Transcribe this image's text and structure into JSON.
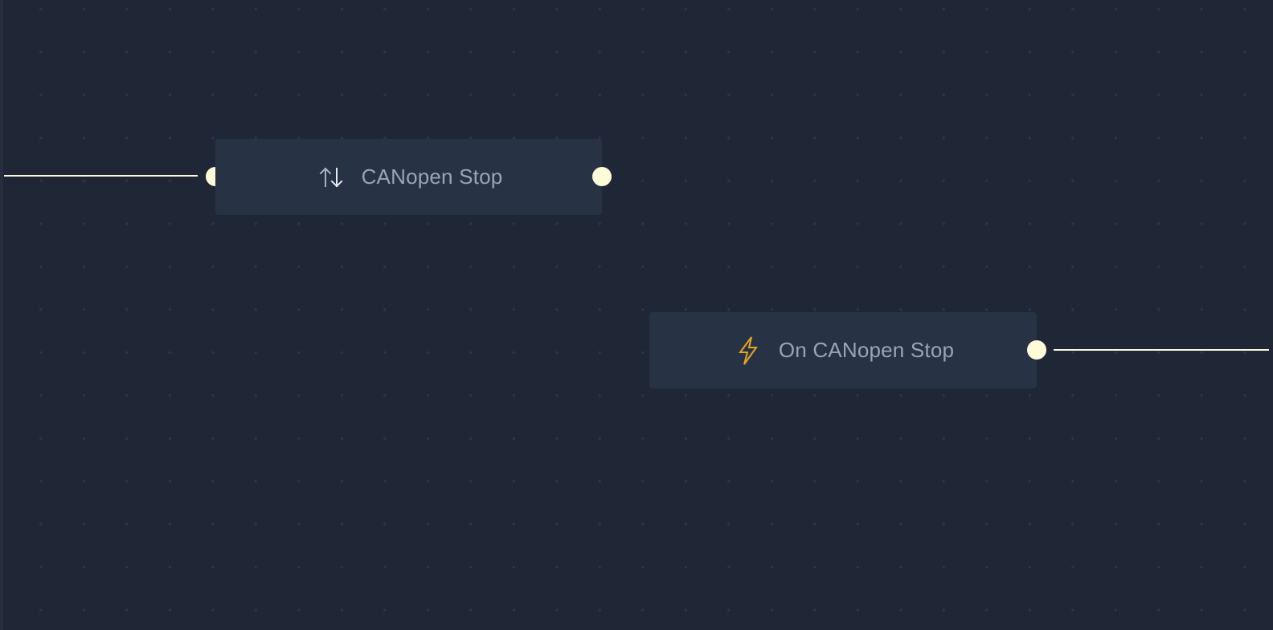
{
  "nodes": {
    "canopen_stop": {
      "label": "CANopen Stop",
      "icon": "transfer-arrows-icon"
    },
    "on_canopen_stop": {
      "label": "On CANopen Stop",
      "icon": "lightning-icon"
    }
  },
  "colors": {
    "background": "#1f2736",
    "node_fill": "#273244",
    "label": "#9aa4b6",
    "port": "#fefbd8",
    "edge": "#fbf8de",
    "lightning": "#e4a623"
  }
}
